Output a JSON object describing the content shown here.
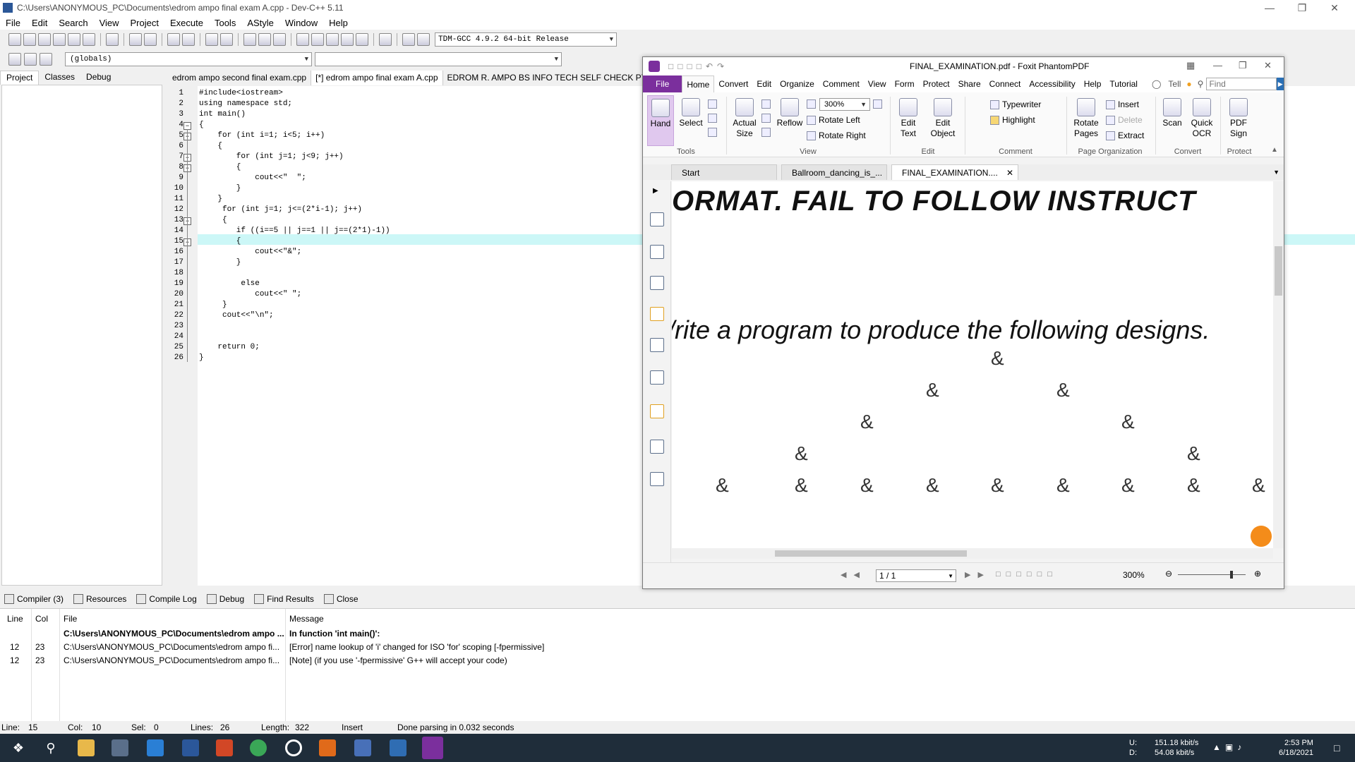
{
  "devcpp": {
    "title": "C:\\Users\\ANONYMOUS_PC\\Documents\\edrom ampo final exam A.cpp - Dev-C++ 5.11",
    "menu": [
      "File",
      "Edit",
      "Search",
      "View",
      "Project",
      "Execute",
      "Tools",
      "AStyle",
      "Window",
      "Help"
    ],
    "compiler": "TDM-GCC 4.9.2 64-bit Release",
    "scope": "(globals)",
    "left_tabs": [
      "Project",
      "Classes",
      "Debug"
    ],
    "editor_tabs": [
      "edrom ampo second final exam.cpp",
      "[*] edrom ampo final exam A.cpp",
      "EDROM R. AMPO BS INFO TECH SELF CHECK PYRAMID"
    ],
    "code_lines": [
      "#include<iostream>",
      "using namespace std;",
      "int main()",
      "{",
      "    for (int i=1; i<5; i++)",
      "    {",
      "        for (int j=1; j<9; j++)",
      "        {",
      "            cout<<\"  \";",
      "        }",
      "    }",
      "     for (int j=1; j<=(2*i-1); j++)",
      "     {",
      "        if ((i==5 || j==1 || j==(2*1)-1))",
      "        {",
      "            cout<<\"&\";",
      "        }",
      "",
      "         else",
      "            cout<<\" \";",
      "     }",
      "     cout<<\"\\n\";",
      "",
      "",
      "    return 0;",
      "}"
    ],
    "bottom_tabs": [
      "Compiler (3)",
      "Resources",
      "Compile Log",
      "Debug",
      "Find Results",
      "Close"
    ],
    "msg_headers": [
      "Line",
      "Col",
      "File",
      "Message"
    ],
    "messages": [
      {
        "line": "",
        "col": "",
        "file": "C:\\Users\\ANONYMOUS_PC\\Documents\\edrom ampo ...",
        "message": "In function 'int main()':",
        "bold": true
      },
      {
        "line": "12",
        "col": "23",
        "file": "C:\\Users\\ANONYMOUS_PC\\Documents\\edrom ampo fi...",
        "message": "[Error] name lookup of 'i' changed for ISO 'for' scoping [-fpermissive]",
        "bold": false
      },
      {
        "line": "12",
        "col": "23",
        "file": "C:\\Users\\ANONYMOUS_PC\\Documents\\edrom ampo fi...",
        "message": "[Note] (if you use '-fpermissive' G++ will accept your code)",
        "bold": false
      }
    ],
    "status": {
      "line": "Line:",
      "line_val": "15",
      "col": "Col:",
      "col_val": "10",
      "sel": "Sel:",
      "sel_val": "0",
      "lines": "Lines:",
      "lines_val": "26",
      "length": "Length:",
      "length_val": "322",
      "mode": "Insert",
      "msg": "Done parsing in 0.032 seconds"
    }
  },
  "foxit": {
    "title": "FINAL_EXAMINATION.pdf - Foxit PhantomPDF",
    "ribbon_tabs": [
      "File",
      "Home",
      "Convert",
      "Edit",
      "Organize",
      "Comment",
      "View",
      "Form",
      "Protect",
      "Share",
      "Connect",
      "Accessibility",
      "Help",
      "Tutorial"
    ],
    "tell": "Tell",
    "find_placeholder": "Find",
    "tools": {
      "hand": "Hand",
      "select": "Select",
      "group": "Tools"
    },
    "view": {
      "actual1": "Actual",
      "actual2": "Size",
      "reflow": "Reflow",
      "zoom": "300%",
      "rotate_left": "Rotate Left",
      "rotate_right": "Rotate Right",
      "group": "View"
    },
    "edit": {
      "edit_text1": "Edit",
      "edit_text2": "Text",
      "edit_obj1": "Edit",
      "edit_obj2": "Object",
      "group": "Edit"
    },
    "comment": {
      "typewriter": "Typewriter",
      "highlight": "Highlight",
      "group": "Comment"
    },
    "organize": {
      "rotate1": "Rotate",
      "rotate2": "Pages",
      "insert": "Insert",
      "delete": "Delete",
      "extract": "Extract",
      "group": "Page Organization"
    },
    "convert": {
      "scan": "Scan",
      "ocr1": "Quick",
      "ocr2": "OCR",
      "group": "Convert"
    },
    "protect": {
      "sign1": "PDF",
      "sign2": "Sign",
      "group": "Protect"
    },
    "doc_tabs": [
      "Start",
      "Ballroom_dancing_is_...",
      "FINAL_EXAMINATION...."
    ],
    "pdf_line1": "ORMAT. FAIL      TO      FOLLOW      INSTRUCT",
    "pdf_line2": "/rite a program to produce the following designs.",
    "amp": "&",
    "page": "1 / 1",
    "zoom_status": "300%"
  },
  "taskbar": {
    "up": "U:",
    "down": "D:",
    "up_speed": "151.18 kbit/s",
    "down_speed": "54.08 kbit/s",
    "time": "2:53 PM",
    "date": "6/18/2021"
  }
}
